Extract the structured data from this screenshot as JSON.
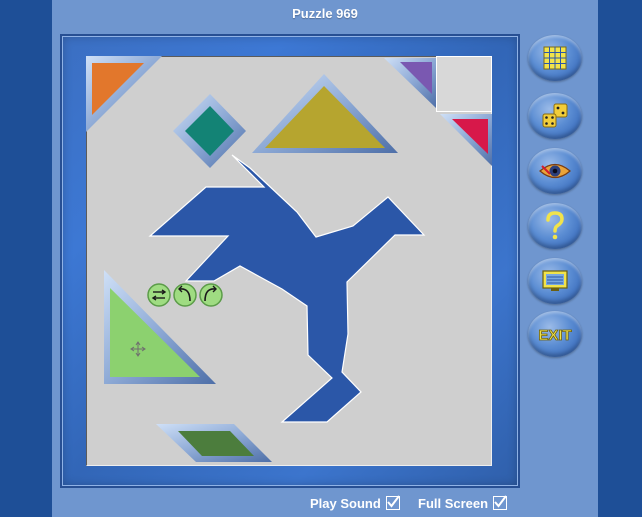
{
  "title": "Puzzle 969",
  "options": {
    "play_sound_label": "Play Sound",
    "play_sound_checked": true,
    "full_screen_label": "Full Screen",
    "full_screen_checked": true
  },
  "sidebar_buttons": [
    {
      "name": "puzzle-grid-button",
      "icon": "grid-icon"
    },
    {
      "name": "dice-button",
      "icon": "dice-icon"
    },
    {
      "name": "show-solution-button",
      "icon": "eye-icon"
    },
    {
      "name": "help-button",
      "icon": "question-icon"
    },
    {
      "name": "screen-button",
      "icon": "monitor-icon"
    },
    {
      "name": "exit-button",
      "icon": "exit-icon",
      "label": "EXIT"
    }
  ],
  "piece_controls": [
    {
      "name": "flip-button",
      "icon": "flip-icon"
    },
    {
      "name": "rotate-left-button",
      "icon": "rotate-left-icon"
    },
    {
      "name": "rotate-right-button",
      "icon": "rotate-right-icon"
    }
  ],
  "colors": {
    "silhouette": "#2b57a8",
    "piece_orange": "#e2772c",
    "piece_purple": "#7a58b1",
    "piece_teal": "#138375",
    "piece_olive": "#b6a52f",
    "piece_red": "#d7184a",
    "piece_light_green": "#8cd16f",
    "piece_dark_green": "#4c7d3d"
  }
}
